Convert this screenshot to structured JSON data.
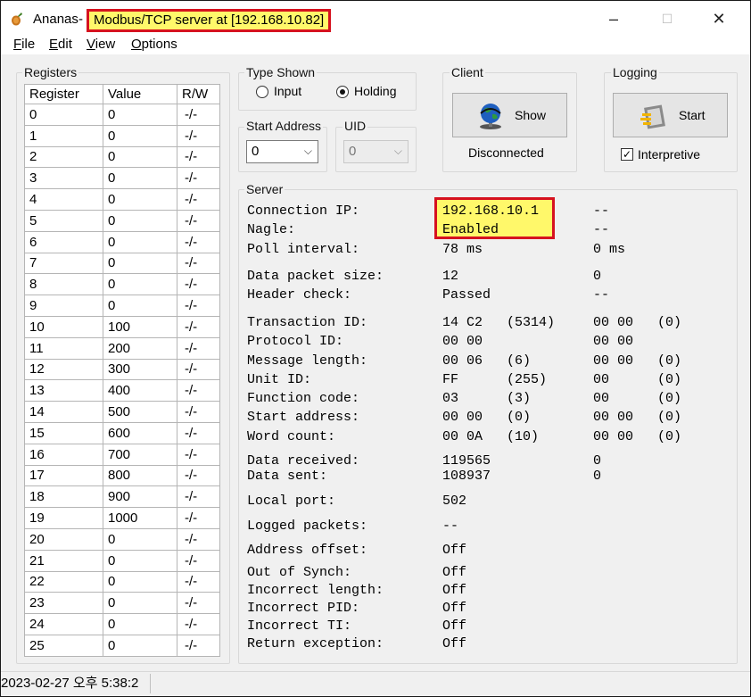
{
  "window": {
    "app_name": "Ananas",
    "separator": "-",
    "subtitle": "Modbus/TCP server at [192.168.10.82]",
    "minimize_glyph": "–",
    "maximize_glyph": "☐",
    "close_glyph": "✕"
  },
  "menu": [
    {
      "first": "F",
      "rest": "ile"
    },
    {
      "first": "E",
      "rest": "dit"
    },
    {
      "first": "V",
      "rest": "iew"
    },
    {
      "first": "O",
      "rest": "ptions"
    }
  ],
  "registers": {
    "group_label": "Registers",
    "headers": [
      "Register",
      "Value",
      "R/W"
    ],
    "rows": [
      [
        "0",
        "0",
        "-/-"
      ],
      [
        "1",
        "0",
        "-/-"
      ],
      [
        "2",
        "0",
        "-/-"
      ],
      [
        "3",
        "0",
        "-/-"
      ],
      [
        "4",
        "0",
        "-/-"
      ],
      [
        "5",
        "0",
        "-/-"
      ],
      [
        "6",
        "0",
        "-/-"
      ],
      [
        "7",
        "0",
        "-/-"
      ],
      [
        "8",
        "0",
        "-/-"
      ],
      [
        "9",
        "0",
        "-/-"
      ],
      [
        "10",
        "100",
        "-/-"
      ],
      [
        "11",
        "200",
        "-/-"
      ],
      [
        "12",
        "300",
        "-/-"
      ],
      [
        "13",
        "400",
        "-/-"
      ],
      [
        "14",
        "500",
        "-/-"
      ],
      [
        "15",
        "600",
        "-/-"
      ],
      [
        "16",
        "700",
        "-/-"
      ],
      [
        "17",
        "800",
        "-/-"
      ],
      [
        "18",
        "900",
        "-/-"
      ],
      [
        "19",
        "1000",
        "-/-"
      ],
      [
        "20",
        "0",
        "-/-"
      ],
      [
        "21",
        "0",
        "-/-"
      ],
      [
        "22",
        "0",
        "-/-"
      ],
      [
        "23",
        "0",
        "-/-"
      ],
      [
        "24",
        "0",
        "-/-"
      ],
      [
        "25",
        "0",
        "-/-"
      ]
    ]
  },
  "type_shown": {
    "label": "Type Shown",
    "options": [
      "Input",
      "Holding"
    ],
    "selected": "Holding"
  },
  "start_address": {
    "label": "Start Address",
    "value": "0"
  },
  "uid": {
    "label": "UID",
    "value": "0"
  },
  "client": {
    "label": "Client",
    "button": "Show",
    "status": "Disconnected"
  },
  "logging": {
    "label": "Logging",
    "button": "Start",
    "checkbox_label": "Interpretive",
    "checked": true
  },
  "server": {
    "label": "Server",
    "rows": [
      {
        "label": "Connection IP:",
        "v1": "192.168.10.1",
        "v2": "",
        "v3": "--",
        "v4": ""
      },
      {
        "label": "Nagle:",
        "v1": "Enabled",
        "v2": "",
        "v3": "--",
        "v4": ""
      },
      {
        "label": "Poll interval:",
        "v1": "78 ms",
        "v2": "",
        "v3": "0 ms",
        "v4": ""
      },
      {
        "label": "Data packet size:",
        "v1": "12",
        "v2": "",
        "v3": "0",
        "v4": ""
      },
      {
        "label": "Header check:",
        "v1": "Passed",
        "v2": "",
        "v3": "--",
        "v4": ""
      },
      {
        "label": "Transaction ID:",
        "v1": "14 C2",
        "v2": "(5314)",
        "v3": "00 00",
        "v4": "(0)"
      },
      {
        "label": "Protocol ID:",
        "v1": "00 00",
        "v2": "",
        "v3": "00 00",
        "v4": ""
      },
      {
        "label": "Message length:",
        "v1": "00 06",
        "v2": "(6)",
        "v3": "00 00",
        "v4": "(0)"
      },
      {
        "label": "Unit ID:",
        "v1": "FF",
        "v2": "(255)",
        "v3": "00",
        "v4": "(0)"
      },
      {
        "label": "Function code:",
        "v1": "03",
        "v2": "(3)",
        "v3": "00",
        "v4": "(0)"
      },
      {
        "label": "Start address:",
        "v1": "00 00",
        "v2": "(0)",
        "v3": "00 00",
        "v4": "(0)"
      },
      {
        "label": "Word count:",
        "v1": "00 0A",
        "v2": "(10)",
        "v3": "00 00",
        "v4": "(0)"
      },
      {
        "label": "Data received:",
        "v1": "119565",
        "v2": "",
        "v3": "0",
        "v4": ""
      },
      {
        "label": "Data sent:",
        "v1": "108937",
        "v2": "",
        "v3": "0",
        "v4": ""
      },
      {
        "label": "Local port:",
        "v1": "502",
        "v2": "",
        "v3": "",
        "v4": ""
      },
      {
        "label": "Logged packets:",
        "v1": "--",
        "v2": "",
        "v3": "",
        "v4": ""
      },
      {
        "label": "Address offset:",
        "v1": "Off",
        "v2": "",
        "v3": "",
        "v4": ""
      },
      {
        "label": "Out of Synch:",
        "v1": "Off",
        "v2": "",
        "v3": "",
        "v4": ""
      },
      {
        "label": "Incorrect length:",
        "v1": "Off",
        "v2": "",
        "v3": "",
        "v4": ""
      },
      {
        "label": "Incorrect PID:",
        "v1": "Off",
        "v2": "",
        "v3": "",
        "v4": ""
      },
      {
        "label": "Incorrect TI:",
        "v1": "Off",
        "v2": "",
        "v3": "",
        "v4": ""
      },
      {
        "label": "Return exception:",
        "v1": "Off",
        "v2": "",
        "v3": "",
        "v4": ""
      }
    ]
  },
  "status": {
    "timestamp": "2023-02-27 오후 5:38:2"
  },
  "colors": {
    "highlight": "#fff86a",
    "highlight_border": "#d6121f"
  }
}
